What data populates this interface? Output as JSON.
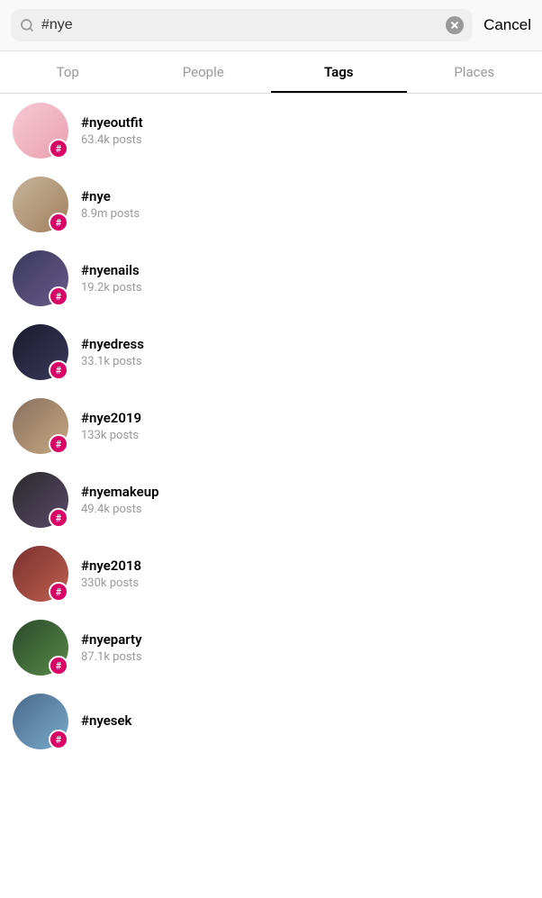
{
  "search": {
    "value": "#nye",
    "placeholder": "Search",
    "clear_label": "×",
    "cancel_label": "Cancel"
  },
  "tabs": [
    {
      "id": "top",
      "label": "Top",
      "active": false
    },
    {
      "id": "people",
      "label": "People",
      "active": false
    },
    {
      "id": "tags",
      "label": "Tags",
      "active": true
    },
    {
      "id": "places",
      "label": "Places",
      "active": false
    }
  ],
  "results": [
    {
      "id": 1,
      "name": "#nyeoutfit",
      "sub": "63.4k posts",
      "avatar_class": "avatar-1"
    },
    {
      "id": 2,
      "name": "#nye",
      "sub": "8.9m posts",
      "avatar_class": "avatar-2"
    },
    {
      "id": 3,
      "name": "#nyenails",
      "sub": "19.2k posts",
      "avatar_class": "avatar-3"
    },
    {
      "id": 4,
      "name": "#nyedress",
      "sub": "33.1k posts",
      "avatar_class": "avatar-4"
    },
    {
      "id": 5,
      "name": "#nye2019",
      "sub": "133k posts",
      "avatar_class": "avatar-5"
    },
    {
      "id": 6,
      "name": "#nyemakeup",
      "sub": "49.4k posts",
      "avatar_class": "avatar-6"
    },
    {
      "id": 7,
      "name": "#nye2018",
      "sub": "330k posts",
      "avatar_class": "avatar-7"
    },
    {
      "id": 8,
      "name": "#nyeparty",
      "sub": "87.1k posts",
      "avatar_class": "avatar-8"
    },
    {
      "id": 9,
      "name": "#nyesek",
      "sub": "",
      "avatar_class": "avatar-9"
    }
  ],
  "hashtag_symbol": "#",
  "colors": {
    "accent": "#d90166",
    "tab_active": "#000000",
    "tab_inactive": "#999999"
  }
}
